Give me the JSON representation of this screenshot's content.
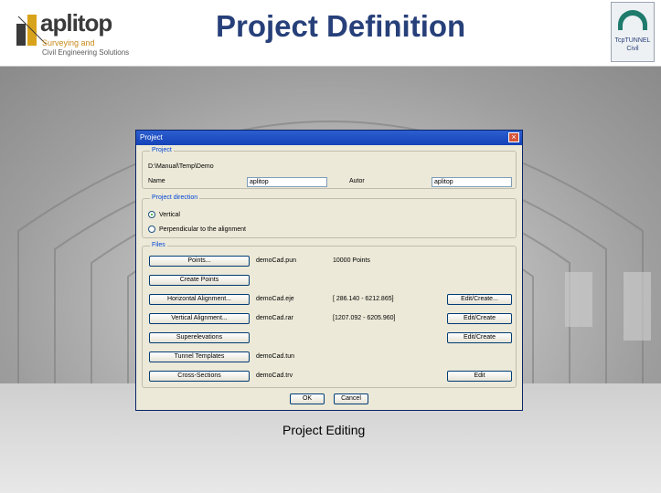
{
  "header": {
    "brand_word": "aplitop",
    "brand_sub1": "Surveying and",
    "brand_sub2": "Civil Engineering Solutions",
    "page_title": "Project Definition",
    "product_line1": "TcpTUNNEL",
    "product_line2": "Civil"
  },
  "dialog": {
    "title": "Project",
    "close_glyph": "×",
    "project_group": {
      "label": "Project",
      "path": "D:\\Manual\\Temp\\Demo",
      "name_label": "Name",
      "name_value": "aplitop",
      "author_label": "Autor",
      "author_value": "aplitop"
    },
    "section_group": {
      "label": "Project direction",
      "options": [
        {
          "label": "Vertical",
          "selected": true
        },
        {
          "label": "Perpendicular to the alignment",
          "selected": false
        }
      ]
    },
    "files_group": {
      "label": "Files",
      "rows": [
        {
          "button": "Points...",
          "file": "demoCad.pun",
          "info": "10000 Points",
          "action": ""
        },
        {
          "button": "Create Points",
          "file": "",
          "info": "",
          "action": ""
        },
        {
          "button": "Horizontal Alignment...",
          "file": "demoCad.eje",
          "info": "[ 286.140 - 6212.865]",
          "action": "Edit/Create..."
        },
        {
          "button": "Vertical Alignment...",
          "file": "demoCad.rar",
          "info": "[1207.092 - 6205.960]",
          "action": "Edit/Create"
        },
        {
          "button": "Superelevations",
          "file": "",
          "info": "",
          "action": "Edit/Create"
        },
        {
          "button": "Tunnel Templates",
          "file": "demoCad.tun",
          "info": "",
          "action": ""
        },
        {
          "button": "Cross-Sections",
          "file": "demoCad.trv",
          "info": "",
          "action": "Edit"
        }
      ]
    },
    "ok_label": "OK",
    "cancel_label": "Cancel"
  },
  "caption": "Project Editing"
}
